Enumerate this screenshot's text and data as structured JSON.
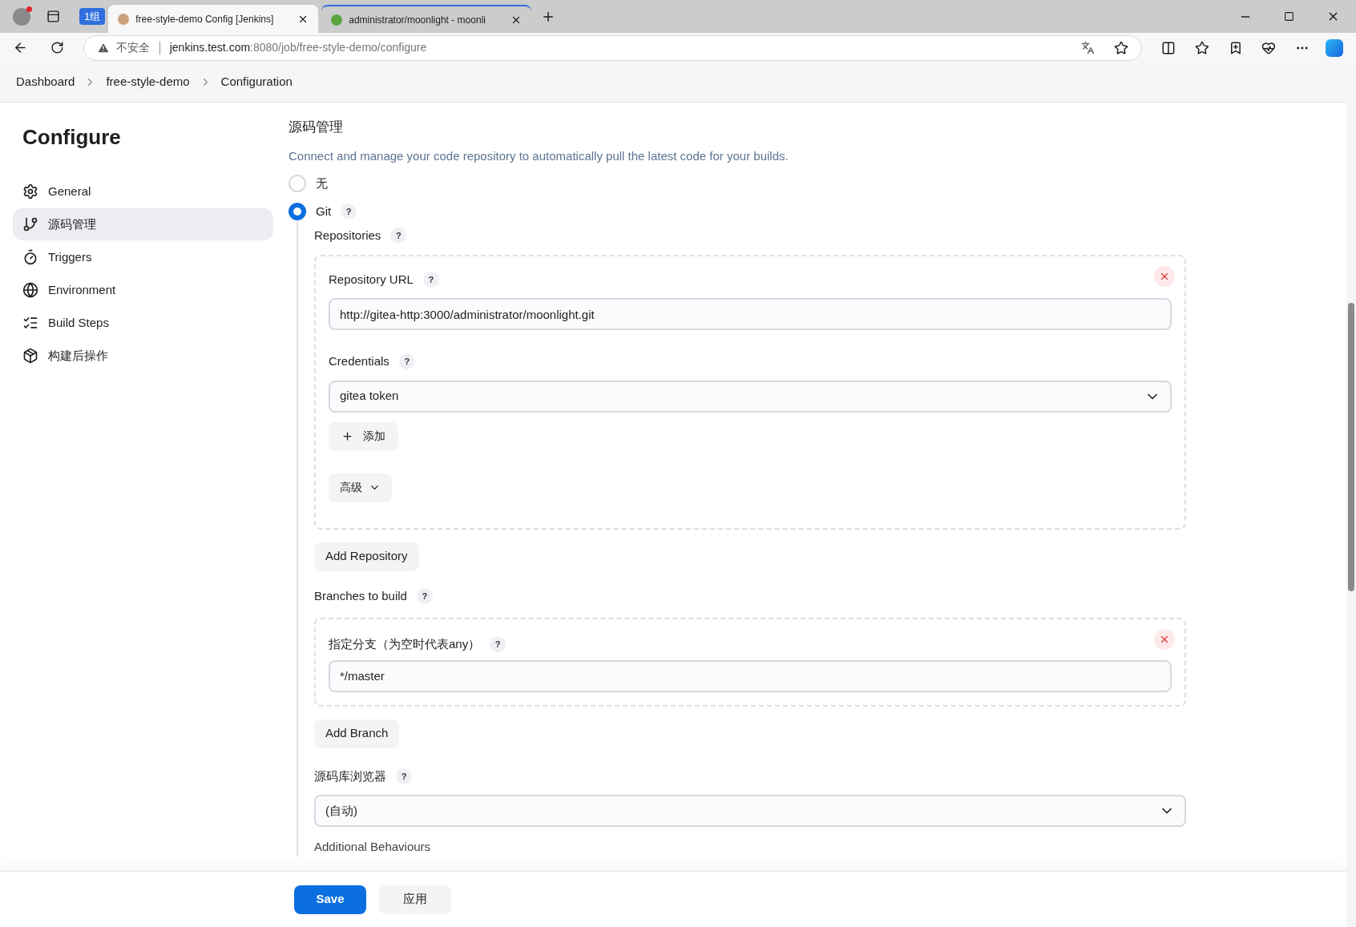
{
  "browser": {
    "group_label": "1组",
    "tabs": [
      {
        "title": "free-style-demo Config [Jenkins]",
        "selected": true
      },
      {
        "title": "administrator/moonlight - moonli",
        "selected": false
      }
    ],
    "address": {
      "security": "不安全",
      "host": "jenkins.test.com",
      "path": ":8080/job/free-style-demo/configure"
    }
  },
  "breadcrumbs": [
    "Dashboard",
    "free-style-demo",
    "Configuration"
  ],
  "sidebar": {
    "title": "Configure",
    "items": [
      {
        "label": "General",
        "selected": false
      },
      {
        "label": "源码管理",
        "selected": true
      },
      {
        "label": "Triggers",
        "selected": false
      },
      {
        "label": "Environment",
        "selected": false
      },
      {
        "label": "Build Steps",
        "selected": false
      },
      {
        "label": "构建后操作",
        "selected": false
      }
    ]
  },
  "section": {
    "title": "源码管理",
    "description": "Connect and manage your code repository to automatically pull the latest code for your builds.",
    "options": [
      {
        "label": "无",
        "selected": false
      },
      {
        "label": "Git",
        "selected": true,
        "help": "?"
      }
    ],
    "repositories": {
      "label": "Repositories",
      "help": "?",
      "items": [
        {
          "url_label": "Repository URL",
          "url_help": "?",
          "url": "http://gitea-http:3000/administrator/moonlight.git",
          "credentials_label": "Credentials",
          "credentials_help": "?",
          "credentials": "gitea token",
          "add_label": "添加",
          "advanced_label": "高级"
        }
      ],
      "add_button": "Add Repository"
    },
    "branches": {
      "label": "Branches to build",
      "help": "?",
      "items": [
        {
          "label": "指定分支（为空时代表any）",
          "help": "?",
          "value": "*/master"
        }
      ],
      "add_button": "Add Branch"
    },
    "repo_browser": {
      "label": "源码库浏览器",
      "help": "?",
      "value": "(自动)"
    },
    "behaviours_label": "Additional Behaviours"
  },
  "footer": {
    "save": "Save",
    "apply": "应用"
  }
}
